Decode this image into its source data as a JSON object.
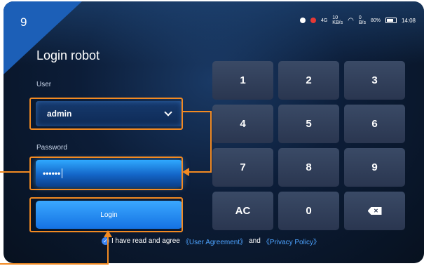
{
  "step": {
    "number": "9"
  },
  "status_bar": {
    "signal": "4G",
    "speed1": "10\nKB/s",
    "speed2": "0\nB/s",
    "battery": "80%",
    "time": "14:08"
  },
  "login": {
    "title": "Login robot",
    "user_label": "User",
    "user_value": "admin",
    "password_label": "Password",
    "password_value": "••••••",
    "button_label": "Login",
    "agreement_prefix": "I have read and agree",
    "user_agreement": "《User Agreement》",
    "and_text": "and",
    "privacy_policy": "《Privacy Policy》"
  },
  "keypad": {
    "keys": [
      "1",
      "2",
      "3",
      "4",
      "5",
      "6",
      "7",
      "8",
      "9",
      "AC",
      "0"
    ]
  },
  "colors": {
    "accent": "#1c5fb7",
    "highlight": "#f28a22",
    "link": "#4da3ff",
    "login_button": "#1572e3"
  },
  "icons": {
    "dropdown": "chevron-down-icon",
    "backspace": "backspace-icon",
    "checkbox": "checkmark-icon",
    "battery": "battery-icon",
    "wifi": "wifi-icon"
  }
}
